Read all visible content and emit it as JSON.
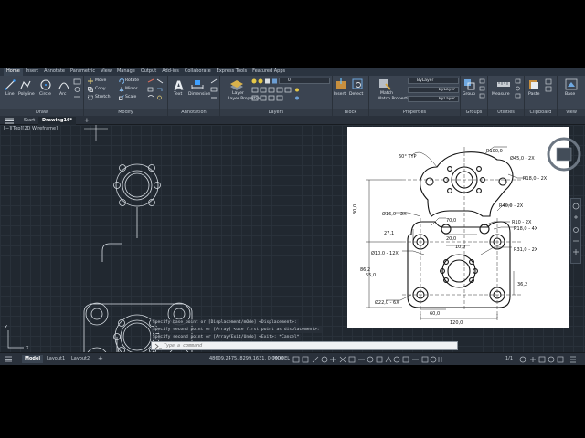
{
  "menu_tabs": [
    "Home",
    "Insert",
    "Annotate",
    "Parametric",
    "View",
    "Manage",
    "Output",
    "Add-ins",
    "Collaborate",
    "Express Tools",
    "Featured Apps"
  ],
  "ribbon": {
    "draw": {
      "title": "Draw",
      "tools": [
        "Line",
        "Polyline",
        "Circle",
        "Arc"
      ]
    },
    "modify": {
      "title": "Modify",
      "tools": [
        "Move",
        "Rotate",
        "Copy",
        "Mirror",
        "Stretch",
        "Scale"
      ]
    },
    "annotation": {
      "title": "Annotation",
      "tools": [
        "Text",
        "Dimension"
      ]
    },
    "layers": {
      "title": "Layers",
      "tools": [
        "Layer Properties"
      ],
      "current_layer": "0"
    },
    "block": {
      "title": "Block",
      "tools": [
        "Insert",
        "Detect"
      ]
    },
    "properties": {
      "title": "Properties",
      "tools": [
        "Match Properties"
      ],
      "color": "ByLayer",
      "linetype": "ByLayer",
      "lineweight": "ByLayer"
    },
    "groups": {
      "title": "Groups",
      "tools": [
        "Group"
      ]
    },
    "utilities": {
      "title": "Utilities",
      "tools": [
        "Measure"
      ]
    },
    "clipboard": {
      "title": "Clipboard",
      "tools": [
        "Paste"
      ]
    },
    "view": {
      "title": "View",
      "tools": [
        "Base"
      ]
    }
  },
  "file_tabs": {
    "start": "Start",
    "drawing": "Drawing16*",
    "add": "+"
  },
  "viewport_label": "[−][Top][2D Wireframe]",
  "reference_drawing": {
    "labels": {
      "r100": "R100,0",
      "d450": "Ø45,0 - 2X",
      "r180": "R18,0 - 2X",
      "a60": "60° TYP",
      "d160": "Ø16,0 - 2X",
      "r400": "R40,0 - 2X",
      "d700": "70,0",
      "r100b": "R10 - 2X",
      "r180b": "R18,0 - 4X",
      "d200": "20,0",
      "d271": "27,1",
      "d300": "30,0",
      "d1000": "10,0",
      "d1012": "Ø10,0 - 12X",
      "r310": "R31,0 - 2X",
      "d550": "55,0",
      "d862": "86,2",
      "d362": "36,2",
      "d220": "Ø22,0 - 6X",
      "d600": "60,0",
      "d1200": "120,0"
    }
  },
  "command_history": [
    "Specify base point or [Displacement/mOde] <Displacement>:",
    "Specify second point or [Array] <use first point as displacement>:",
    "Specify second point or [Array/Exit/Undo] <Exit>: *Cancel*"
  ],
  "command_placeholder": "Type a command",
  "status": {
    "layout_tabs": [
      "Model",
      "Layout1",
      "Layout2"
    ],
    "add": "+",
    "coordinates": "48609.2475, 8299.1631, 0.0000",
    "mode": "MODEL",
    "scale": "1/1"
  },
  "colors": {
    "background": "#212830",
    "ribbon": "#3b4451",
    "geometry": "#d7dde3",
    "accent": "#1b78d0"
  }
}
